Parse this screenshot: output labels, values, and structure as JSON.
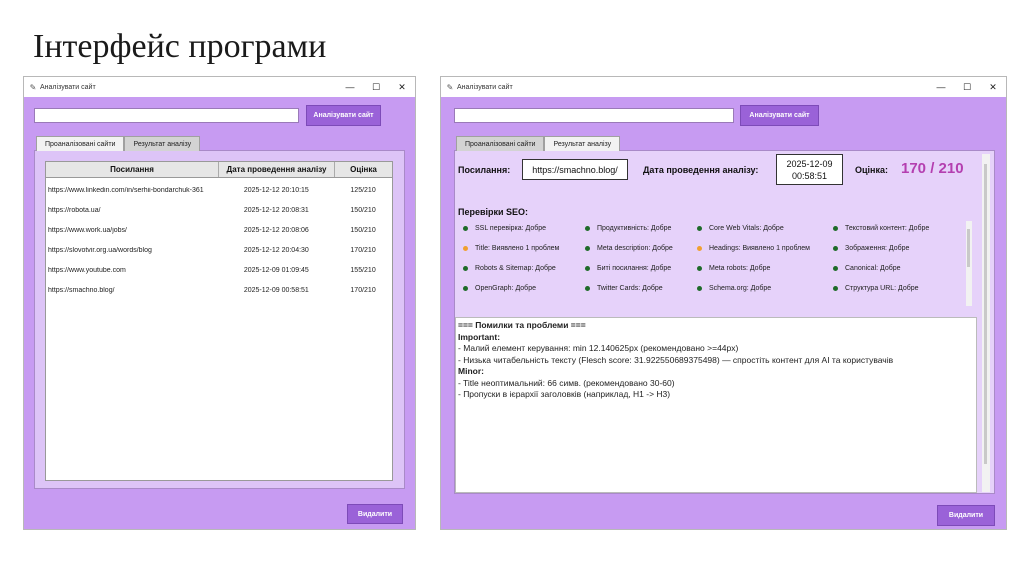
{
  "slide_title": "Інтерфейс програми",
  "left_window": {
    "title": "Аналізувати сайт",
    "analyze_button": "Аналізувати сайт",
    "url_value": "",
    "tabs": [
      "Проаналізовані сайти",
      "Результат аналізу"
    ],
    "active_tab": 0,
    "columns": [
      "Посилання",
      "Дата проведення аналізу",
      "Оцінка"
    ],
    "rows": [
      [
        "https://www.linkedin.com/in/serhii-bondarchuk-361",
        "2025-12-12 20:10:15",
        "125/210"
      ],
      [
        "https://robota.ua/",
        "2025-12-12 20:08:31",
        "150/210"
      ],
      [
        "https://www.work.ua/jobs/",
        "2025-12-12 20:08:06",
        "150/210"
      ],
      [
        "https://slovotvir.org.ua/words/blog",
        "2025-12-12 20:04:30",
        "170/210"
      ],
      [
        "https://www.youtube.com",
        "2025-12-09 01:09:45",
        "155/210"
      ],
      [
        "https://smachno.blog/",
        "2025-12-09 00:58:51",
        "170/210"
      ]
    ],
    "delete_button": "Видалити"
  },
  "right_window": {
    "title": "Аналізувати сайт",
    "analyze_button": "Аналізувати сайт",
    "url_value": "",
    "tabs": [
      "Проаналізовані сайти",
      "Результат аналізу"
    ],
    "active_tab": 1,
    "link_label": "Посилання:",
    "link_value": "https://smachno.blog/",
    "date_label": "Дата проведення аналізу:",
    "date_value_1": "2025-12-09",
    "date_value_2": "00:58:51",
    "score_label": "Оцінка:",
    "score_value": "170 / 210",
    "seo_label": "Перевірки SEO:",
    "checks": [
      {
        "text": "SSL перевірка: Добре",
        "color": "#1f6b2a"
      },
      {
        "text": "Продуктивність: Добре",
        "color": "#1f6b2a"
      },
      {
        "text": "Core Web Vitals: Добре",
        "color": "#1f6b2a"
      },
      {
        "text": "Текстовий контент: Добре",
        "color": "#1f6b2a"
      },
      {
        "text": "Title: Виявлено 1 проблем",
        "color": "#f0a030"
      },
      {
        "text": "Meta description: Добре",
        "color": "#1f6b2a"
      },
      {
        "text": "Headings: Виявлено 1 проблем",
        "color": "#f0a030"
      },
      {
        "text": "Зображення: Добре",
        "color": "#1f6b2a"
      },
      {
        "text": "Robots & Sitemap: Добре",
        "color": "#1f6b2a"
      },
      {
        "text": "Биті посилання: Добре",
        "color": "#1f6b2a"
      },
      {
        "text": "Meta robots: Добре",
        "color": "#1f6b2a"
      },
      {
        "text": "Canonical: Добре",
        "color": "#1f6b2a"
      },
      {
        "text": "OpenGraph: Добре",
        "color": "#1f6b2a"
      },
      {
        "text": "Twitter Cards: Добре",
        "color": "#1f6b2a"
      },
      {
        "text": "Schema.org: Добре",
        "color": "#1f6b2a"
      },
      {
        "text": "Структура URL: Добре",
        "color": "#1f6b2a"
      }
    ],
    "report": [
      {
        "text": "=== Помилки та проблеми ===",
        "bold": true
      },
      {
        "text": "Important:",
        "bold": true
      },
      {
        "text": "- Малий елемент керування: min 12.140625px (рекомендовано >=44px)",
        "bold": false
      },
      {
        "text": "- Низька читабельність тексту (Flesch score: 31.922550689375498) — спростіть контент для AI та користувачів",
        "bold": false
      },
      {
        "text": "Minor:",
        "bold": true
      },
      {
        "text": "- Title неоптимальний: 66 симв. (рекомендовано 30-60)",
        "bold": false
      },
      {
        "text": "- Пропуски в ієрархії заголовків (наприклад, H1 -> H3)",
        "bold": false
      }
    ],
    "delete_button": "Видалити"
  },
  "colors": {
    "window_bg": "#c79bf2",
    "accent_button": "#9a62d8",
    "score": "#b43fb0",
    "ok_dot": "#1f6b2a",
    "warn_dot": "#f0a030"
  },
  "window_controls": [
    "minimize-icon",
    "maximize-icon",
    "close-icon"
  ]
}
